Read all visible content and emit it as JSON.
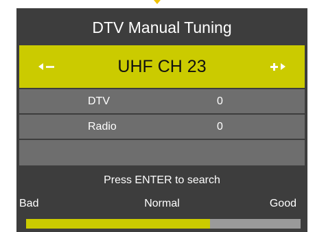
{
  "menu": {
    "title": "DTV Manual Tuning",
    "channel": "UHF CH 23",
    "rows": [
      {
        "label": "DTV",
        "value": "0"
      },
      {
        "label": "Radio",
        "value": "0"
      }
    ],
    "hint": "Press ENTER to search"
  },
  "signal": {
    "labels": {
      "bad": "Bad",
      "normal": "Normal",
      "good": "Good"
    },
    "strength": 0.67
  },
  "icons": {
    "left": "arrow-left-icon",
    "minus": "minus-icon",
    "plus": "plus-icon",
    "right": "arrow-right-icon"
  },
  "colors": {
    "panel": "#3d3d3d",
    "highlight": "#cbcb00",
    "row": "#6e6e6e",
    "track": "#9a9a9a"
  }
}
